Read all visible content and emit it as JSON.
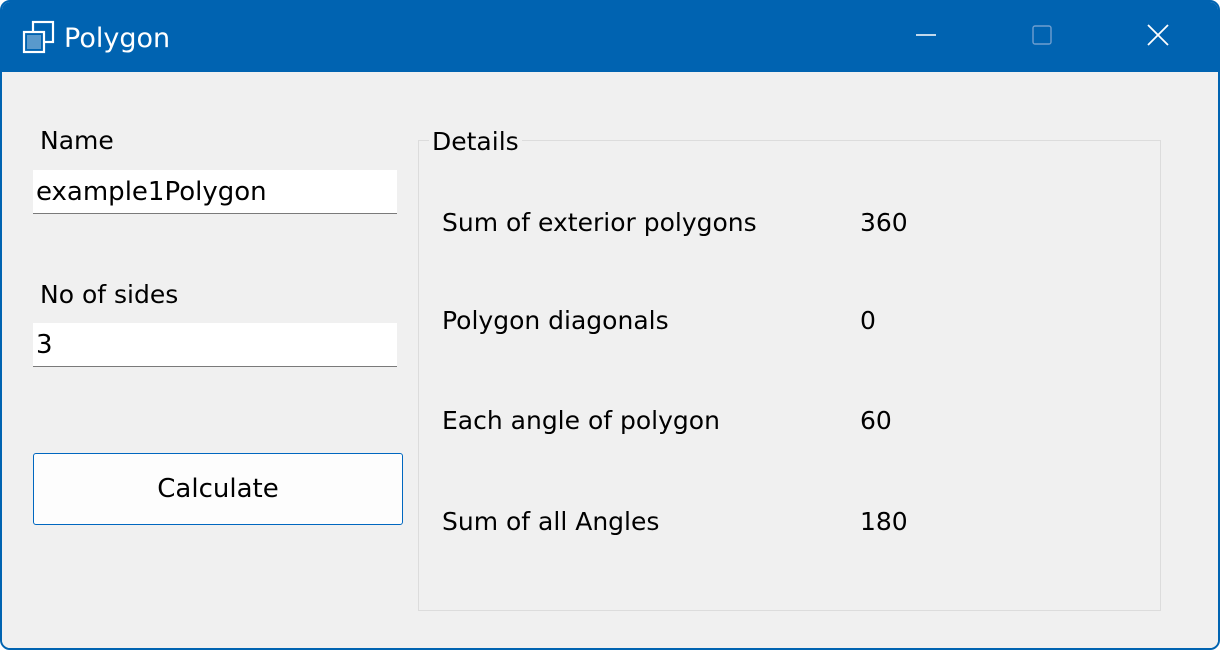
{
  "window": {
    "title": "Polygon"
  },
  "form": {
    "name_label": "Name",
    "name_value": "example1Polygon",
    "sides_label": "No of sides",
    "sides_value": "3",
    "calculate_label": "Calculate"
  },
  "details": {
    "title": "Details",
    "rows": [
      {
        "label": "Sum of exterior polygons",
        "value": "360"
      },
      {
        "label": "Polygon diagonals",
        "value": "0"
      },
      {
        "label": "Each angle of polygon",
        "value": "60"
      },
      {
        "label": "Sum of all Angles",
        "value": "180"
      }
    ]
  },
  "icons": {
    "app": "polygon-app-icon",
    "minimize": "minimize-icon",
    "maximize": "maximize-icon",
    "close": "close-icon"
  },
  "colors": {
    "titlebar": "#0063b1",
    "window_bg": "#f0f0f0",
    "accent_border": "#0067c0"
  }
}
